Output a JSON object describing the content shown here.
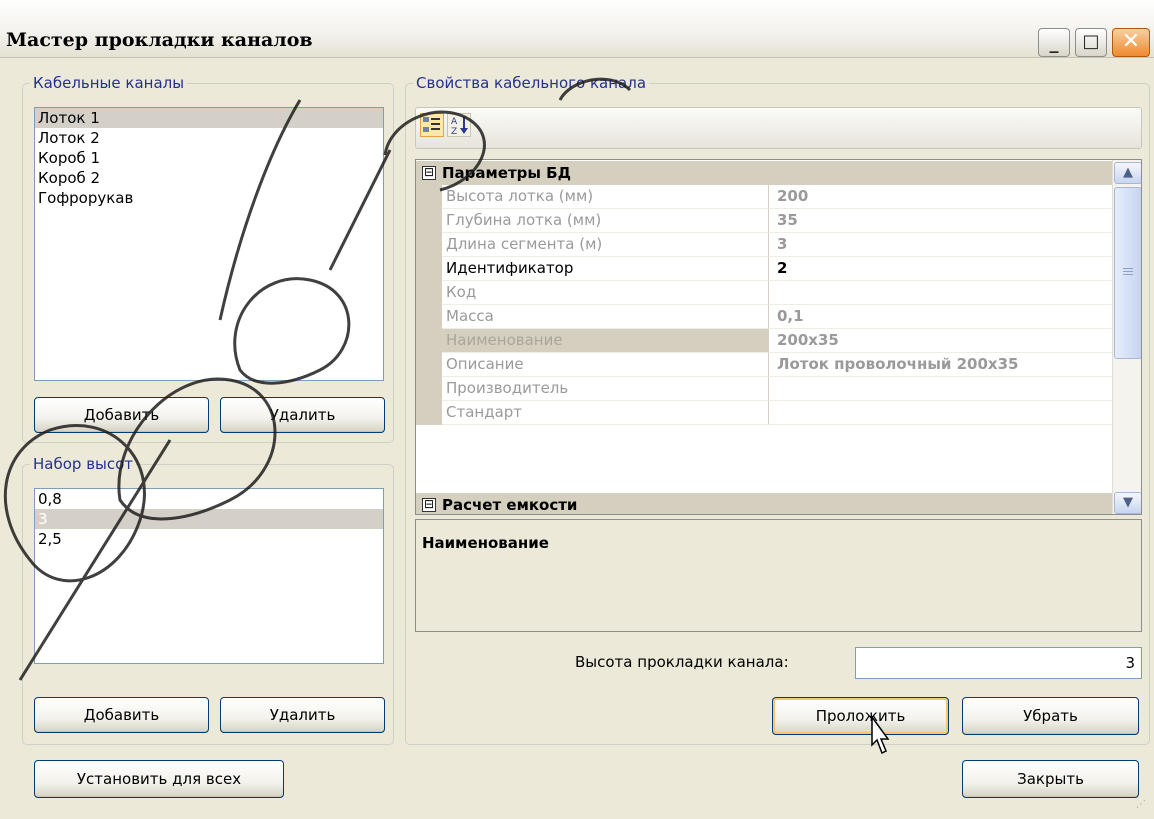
{
  "window": {
    "title": "Мастер прокладки каналов",
    "controls": {
      "minimize": "_",
      "maximize": "□",
      "close": "✕"
    }
  },
  "channels": {
    "legend": "Кабельные каналы",
    "items": [
      "Лоток 1",
      "Лоток 2",
      "Короб 1",
      "Короб 2",
      "Гофрорукав"
    ],
    "selected_index": 0,
    "add_label": "Добавить",
    "remove_label": "Удалить"
  },
  "heights": {
    "legend": "Набор высот",
    "items": [
      "0,8",
      "3",
      "2,5"
    ],
    "selected_index": 1,
    "add_label": "Добавить",
    "remove_label": "Удалить"
  },
  "properties": {
    "legend": "Свойства кабельного канала",
    "toolbar": {
      "categorized_icon": "categorized-icon",
      "alphabetical_icon": "sort-az-icon",
      "alpha_text": "A\n2"
    },
    "categories": [
      {
        "label": "Параметры БД",
        "expander": "⊟"
      },
      {
        "label": "Расчет емкости",
        "expander": "⊟"
      }
    ],
    "rows": [
      {
        "name": "Высота лотка (мм)",
        "value": "200"
      },
      {
        "name": "Глубина лотка (мм)",
        "value": "35"
      },
      {
        "name": "Длина сегмента (м)",
        "value": "3"
      },
      {
        "name": "Идентификатор",
        "value": "2"
      },
      {
        "name": "Код",
        "value": ""
      },
      {
        "name": "Масса",
        "value": "0,1"
      },
      {
        "name": "Наименование",
        "value": "200x35"
      },
      {
        "name": "Описание",
        "value": "Лоток проволочный 200x35"
      },
      {
        "name": "Производитель",
        "value": ""
      },
      {
        "name": "Стандарт",
        "value": ""
      }
    ],
    "description_title": "Наименование"
  },
  "laying": {
    "height_label": "Высота прокладки канала:",
    "height_value": "3",
    "lay_label": "Проложить",
    "remove_label": "Убрать"
  },
  "footer": {
    "set_all_label": "Установить для всех",
    "close_label": "Закрыть"
  },
  "colors": {
    "accent": "#23318d",
    "selection": "#d4d0c8",
    "category": "#d4cfbf",
    "watermark": "#1a1a1a"
  }
}
